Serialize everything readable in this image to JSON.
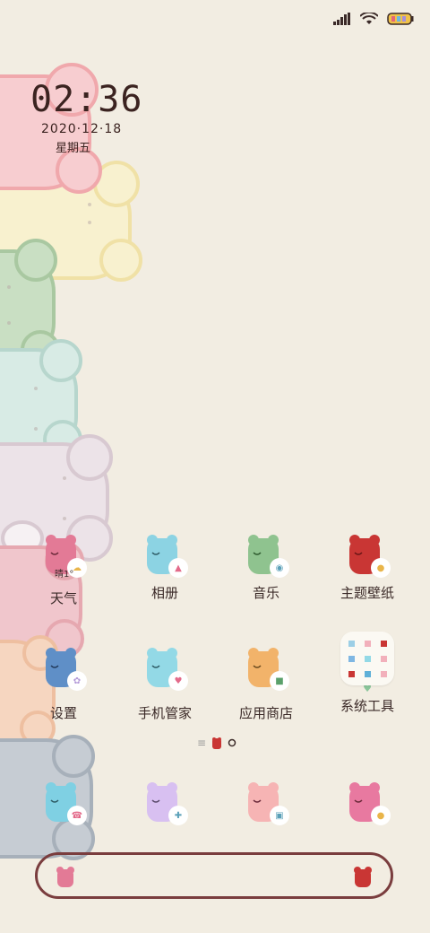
{
  "clock": {
    "time": "02:36",
    "date": "2020·12·18",
    "weekday": "星期五"
  },
  "weather": {
    "condition": "晴",
    "temp": "1°"
  },
  "apps": [
    {
      "id": "weather",
      "label": "天气",
      "bear_color": "#e37a96",
      "badge": "cloud-sun-icon"
    },
    {
      "id": "gallery",
      "label": "相册",
      "bear_color": "#8cd3e3",
      "badge": "photo-icon"
    },
    {
      "id": "music",
      "label": "音乐",
      "bear_color": "#8fc38f",
      "badge": "music-disc-icon"
    },
    {
      "id": "themes",
      "label": "主题壁纸",
      "bear_color": "#c93634",
      "badge": "cat-icon"
    },
    {
      "id": "settings",
      "label": "设置",
      "bear_color": "#5f8fc7",
      "badge": "gear-icon"
    },
    {
      "id": "security",
      "label": "手机管家",
      "bear_color": "#93d9e6",
      "badge": "shield-icon"
    },
    {
      "id": "appstore",
      "label": "应用商店",
      "bear_color": "#f2b36a",
      "badge": "store-icon"
    },
    {
      "id": "tools",
      "label": "系统工具",
      "bear_color": "",
      "badge": "folder-icon"
    }
  ],
  "dock": [
    {
      "id": "phone",
      "bear_color": "#7fd0e3",
      "badge": "phone-icon"
    },
    {
      "id": "messages",
      "bear_color": "#d8c0f1",
      "badge": "chat-icon"
    },
    {
      "id": "browser",
      "bear_color": "#f6b4b4",
      "badge": "browser-icon"
    },
    {
      "id": "camera",
      "bear_color": "#e879a0",
      "badge": "camera-icon"
    }
  ],
  "colors": {
    "background": "#f2ede2",
    "text": "#3b2a28",
    "search_border": "#7a3d3e"
  }
}
